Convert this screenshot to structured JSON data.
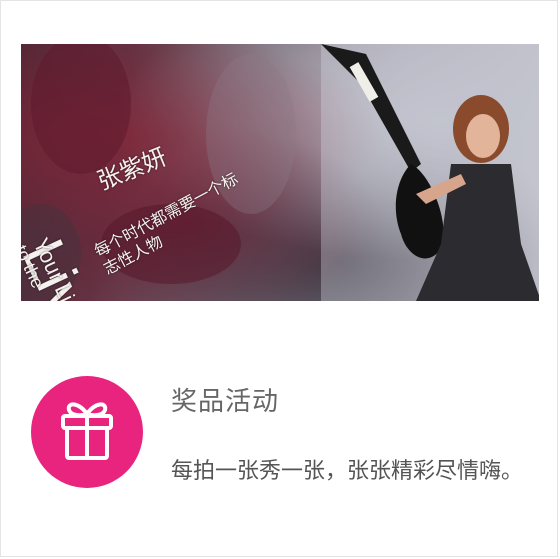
{
  "banner": {
    "headline_cn": "每个时代都需要一个标志性人物",
    "name_cn": "张紫妍",
    "live_text": "Live",
    "your_text": "Your Li",
    "tothe_text": "to the"
  },
  "card": {
    "title": "奖品活动",
    "description": "每拍一张秀一张，张张精彩尽情嗨。"
  },
  "colors": {
    "gift_circle": "#e8247f",
    "title_text": "#666666",
    "desc_text": "#555555"
  },
  "icons": {
    "gift": "gift-icon"
  }
}
